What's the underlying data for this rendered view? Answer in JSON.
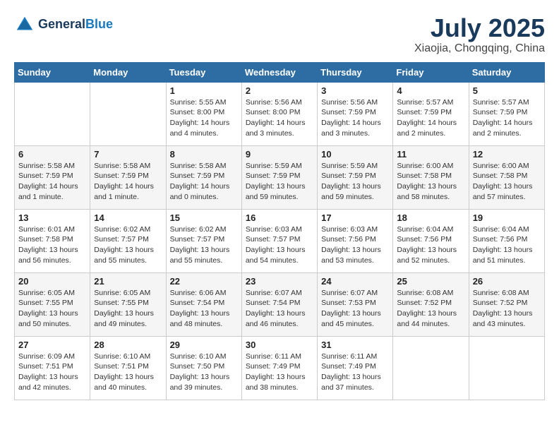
{
  "header": {
    "logo_line1": "General",
    "logo_line2": "Blue",
    "month": "July 2025",
    "location": "Xiaojia, Chongqing, China"
  },
  "weekdays": [
    "Sunday",
    "Monday",
    "Tuesday",
    "Wednesday",
    "Thursday",
    "Friday",
    "Saturday"
  ],
  "weeks": [
    [
      {
        "day": "",
        "info": ""
      },
      {
        "day": "",
        "info": ""
      },
      {
        "day": "1",
        "info": "Sunrise: 5:55 AM\nSunset: 8:00 PM\nDaylight: 14 hours\nand 4 minutes."
      },
      {
        "day": "2",
        "info": "Sunrise: 5:56 AM\nSunset: 8:00 PM\nDaylight: 14 hours\nand 3 minutes."
      },
      {
        "day": "3",
        "info": "Sunrise: 5:56 AM\nSunset: 7:59 PM\nDaylight: 14 hours\nand 3 minutes."
      },
      {
        "day": "4",
        "info": "Sunrise: 5:57 AM\nSunset: 7:59 PM\nDaylight: 14 hours\nand 2 minutes."
      },
      {
        "day": "5",
        "info": "Sunrise: 5:57 AM\nSunset: 7:59 PM\nDaylight: 14 hours\nand 2 minutes."
      }
    ],
    [
      {
        "day": "6",
        "info": "Sunrise: 5:58 AM\nSunset: 7:59 PM\nDaylight: 14 hours\nand 1 minute."
      },
      {
        "day": "7",
        "info": "Sunrise: 5:58 AM\nSunset: 7:59 PM\nDaylight: 14 hours\nand 1 minute."
      },
      {
        "day": "8",
        "info": "Sunrise: 5:58 AM\nSunset: 7:59 PM\nDaylight: 14 hours\nand 0 minutes."
      },
      {
        "day": "9",
        "info": "Sunrise: 5:59 AM\nSunset: 7:59 PM\nDaylight: 13 hours\nand 59 minutes."
      },
      {
        "day": "10",
        "info": "Sunrise: 5:59 AM\nSunset: 7:59 PM\nDaylight: 13 hours\nand 59 minutes."
      },
      {
        "day": "11",
        "info": "Sunrise: 6:00 AM\nSunset: 7:58 PM\nDaylight: 13 hours\nand 58 minutes."
      },
      {
        "day": "12",
        "info": "Sunrise: 6:00 AM\nSunset: 7:58 PM\nDaylight: 13 hours\nand 57 minutes."
      }
    ],
    [
      {
        "day": "13",
        "info": "Sunrise: 6:01 AM\nSunset: 7:58 PM\nDaylight: 13 hours\nand 56 minutes."
      },
      {
        "day": "14",
        "info": "Sunrise: 6:02 AM\nSunset: 7:57 PM\nDaylight: 13 hours\nand 55 minutes."
      },
      {
        "day": "15",
        "info": "Sunrise: 6:02 AM\nSunset: 7:57 PM\nDaylight: 13 hours\nand 55 minutes."
      },
      {
        "day": "16",
        "info": "Sunrise: 6:03 AM\nSunset: 7:57 PM\nDaylight: 13 hours\nand 54 minutes."
      },
      {
        "day": "17",
        "info": "Sunrise: 6:03 AM\nSunset: 7:56 PM\nDaylight: 13 hours\nand 53 minutes."
      },
      {
        "day": "18",
        "info": "Sunrise: 6:04 AM\nSunset: 7:56 PM\nDaylight: 13 hours\nand 52 minutes."
      },
      {
        "day": "19",
        "info": "Sunrise: 6:04 AM\nSunset: 7:56 PM\nDaylight: 13 hours\nand 51 minutes."
      }
    ],
    [
      {
        "day": "20",
        "info": "Sunrise: 6:05 AM\nSunset: 7:55 PM\nDaylight: 13 hours\nand 50 minutes."
      },
      {
        "day": "21",
        "info": "Sunrise: 6:05 AM\nSunset: 7:55 PM\nDaylight: 13 hours\nand 49 minutes."
      },
      {
        "day": "22",
        "info": "Sunrise: 6:06 AM\nSunset: 7:54 PM\nDaylight: 13 hours\nand 48 minutes."
      },
      {
        "day": "23",
        "info": "Sunrise: 6:07 AM\nSunset: 7:54 PM\nDaylight: 13 hours\nand 46 minutes."
      },
      {
        "day": "24",
        "info": "Sunrise: 6:07 AM\nSunset: 7:53 PM\nDaylight: 13 hours\nand 45 minutes."
      },
      {
        "day": "25",
        "info": "Sunrise: 6:08 AM\nSunset: 7:52 PM\nDaylight: 13 hours\nand 44 minutes."
      },
      {
        "day": "26",
        "info": "Sunrise: 6:08 AM\nSunset: 7:52 PM\nDaylight: 13 hours\nand 43 minutes."
      }
    ],
    [
      {
        "day": "27",
        "info": "Sunrise: 6:09 AM\nSunset: 7:51 PM\nDaylight: 13 hours\nand 42 minutes."
      },
      {
        "day": "28",
        "info": "Sunrise: 6:10 AM\nSunset: 7:51 PM\nDaylight: 13 hours\nand 40 minutes."
      },
      {
        "day": "29",
        "info": "Sunrise: 6:10 AM\nSunset: 7:50 PM\nDaylight: 13 hours\nand 39 minutes."
      },
      {
        "day": "30",
        "info": "Sunrise: 6:11 AM\nSunset: 7:49 PM\nDaylight: 13 hours\nand 38 minutes."
      },
      {
        "day": "31",
        "info": "Sunrise: 6:11 AM\nSunset: 7:49 PM\nDaylight: 13 hours\nand 37 minutes."
      },
      {
        "day": "",
        "info": ""
      },
      {
        "day": "",
        "info": ""
      }
    ]
  ]
}
